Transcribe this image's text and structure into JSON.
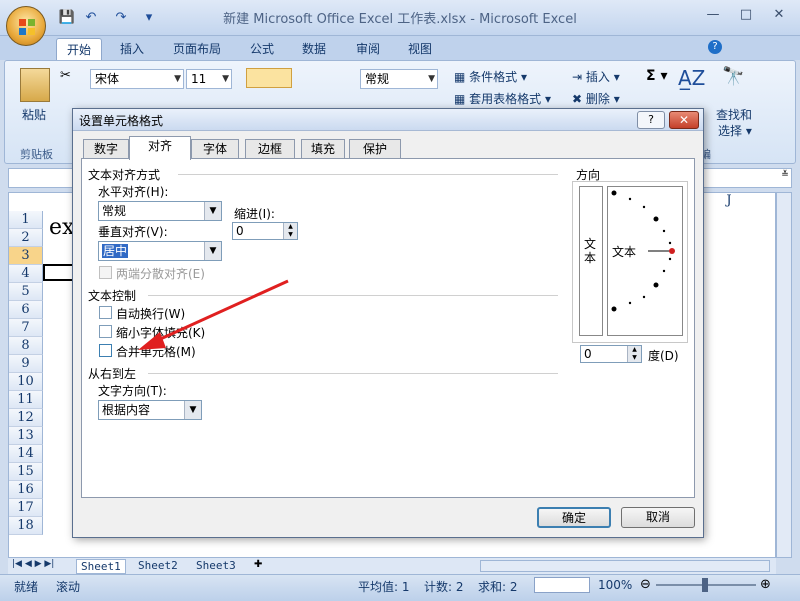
{
  "app": {
    "title": "新建 Microsoft Office Excel 工作表.xlsx - Microsoft Excel",
    "qat": [
      "💾",
      "↶",
      "↷",
      "▾"
    ],
    "window_controls": [
      "—",
      "□",
      "✕"
    ]
  },
  "ribbon": {
    "tabs": [
      "开始",
      "插入",
      "页面布局",
      "公式",
      "数据",
      "审阅",
      "视图"
    ],
    "active_tab": "开始",
    "clipboard": {
      "paste_label": "粘贴",
      "group_label": "剪贴板"
    },
    "font": {
      "name": "宋体",
      "size": "11"
    },
    "number": {
      "format": "常规"
    },
    "styles": {
      "conditional": "条件格式",
      "table": "套用表格格式"
    },
    "cells": {
      "insert": "插入",
      "delete": "删除"
    },
    "editing": {
      "sort": "排序和",
      "find": "查找和",
      "select": "选择",
      "group_label": "编"
    }
  },
  "sheet": {
    "column_j": "J",
    "rows": [
      "1",
      "2",
      "3",
      "4",
      "5",
      "6",
      "7",
      "8",
      "9",
      "10",
      "11",
      "12",
      "13",
      "14",
      "15",
      "16",
      "17",
      "18"
    ],
    "selected_row": "3",
    "cell_text": "ex",
    "tabs": [
      "Sheet1",
      "Sheet2",
      "Sheet3"
    ]
  },
  "status": {
    "ready": "就绪",
    "scroll": "滚动",
    "average": "平均值: 1",
    "count": "计数: 2",
    "sum": "求和: 2",
    "zoom": "100%"
  },
  "dialog": {
    "title": "设置单元格格式",
    "help": "?",
    "close": "✕",
    "tabs": [
      "数字",
      "对齐",
      "字体",
      "边框",
      "填充",
      "保护"
    ],
    "active_tab": "对齐",
    "text_alignment": {
      "section": "文本对齐方式",
      "horizontal_label": "水平对齐(H):",
      "horizontal_value": "常规",
      "indent_label": "缩进(I):",
      "indent_value": "0",
      "vertical_label": "垂直对齐(V):",
      "vertical_value": "居中",
      "justify_distributed": "两端分散对齐(E)"
    },
    "text_control": {
      "section": "文本控制",
      "wrap": "自动换行(W)",
      "shrink": "缩小字体填充(K)",
      "merge": "合并单元格(M)"
    },
    "rtl": {
      "section": "从右到左",
      "direction_label": "文字方向(T):",
      "direction_value": "根据内容"
    },
    "orientation": {
      "section": "方向",
      "vertical_text": "文本",
      "text": "文本",
      "degrees_value": "0",
      "degrees_label": "度(D)"
    },
    "ok": "确定",
    "cancel": "取消"
  },
  "colors": {
    "arrow": "#e02020",
    "selected_highlight": "#316ac5",
    "row_selected": "#f8d48a"
  }
}
